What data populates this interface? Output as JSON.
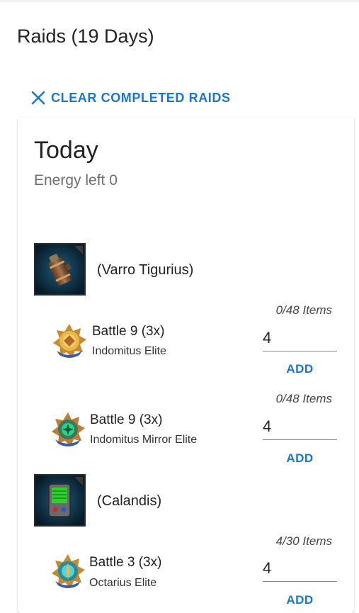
{
  "page": {
    "title": "Raids (19 Days)"
  },
  "actions": {
    "clear_label": "CLEAR COMPLETED RAIDS",
    "clear_icon": "close-icon"
  },
  "day": {
    "title": "Today",
    "energy": "Energy left 0"
  },
  "groups": [
    {
      "character": "(Varro Tigurius)",
      "icon": "canister-item-icon",
      "battles": [
        {
          "items": "0/48 Items",
          "title": "Battle 9 (3x)",
          "subtitle": "Indomitus Elite",
          "qty": "4",
          "add": "ADD",
          "badge": "indomitus-elite-icon"
        },
        {
          "items": "0/48 Items",
          "title": "Battle 9 (3x)",
          "subtitle": "Indomitus Mirror Elite",
          "qty": "4",
          "add": "ADD",
          "badge": "indomitus-mirror-elite-icon"
        }
      ]
    },
    {
      "character": "(Calandis)",
      "icon": "scanner-item-icon",
      "battles": [
        {
          "items": "4/30 Items",
          "title": "Battle 3 (3x)",
          "subtitle": "Octarius Elite",
          "qty": "4",
          "add": "ADD",
          "badge": "octarius-elite-icon"
        }
      ]
    }
  ],
  "colors": {
    "accent": "#1976d2",
    "text": "#222222",
    "muted": "#6e6e6e"
  }
}
